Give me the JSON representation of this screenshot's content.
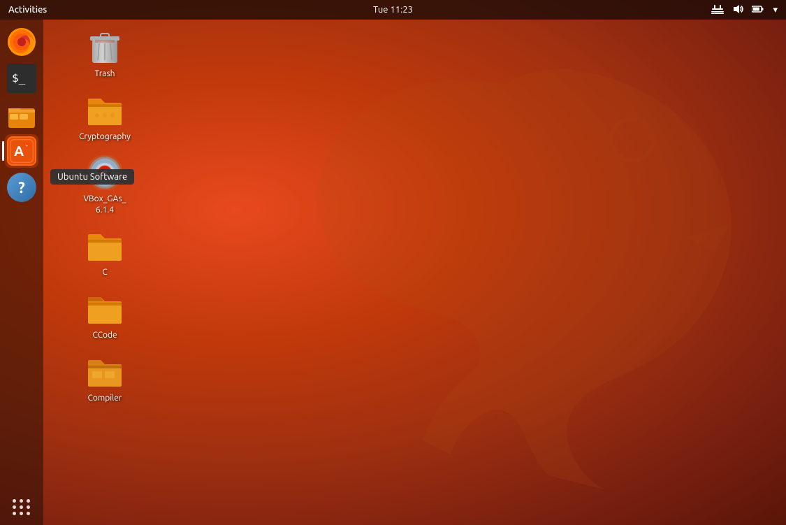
{
  "panel": {
    "activities_label": "Activities",
    "clock": "Tue 11:23",
    "icons": [
      {
        "name": "network-icon",
        "symbol": "⊞",
        "unicode": "🔗"
      },
      {
        "name": "volume-icon",
        "symbol": "🔊"
      },
      {
        "name": "battery-icon",
        "symbol": "🔋"
      },
      {
        "name": "menu-arrow-icon",
        "symbol": "▾"
      }
    ]
  },
  "dock": {
    "items": [
      {
        "name": "firefox",
        "label": "Firefox"
      },
      {
        "name": "terminal",
        "label": "Terminal"
      },
      {
        "name": "files",
        "label": "Files"
      },
      {
        "name": "ubuntu-software",
        "label": "Ubuntu Software",
        "active": true
      },
      {
        "name": "help",
        "label": "Help"
      }
    ],
    "apps_grid_label": "Show Applications"
  },
  "tooltip": {
    "text": "Ubuntu Software"
  },
  "desktop_icons": [
    {
      "name": "trash",
      "label": "Trash",
      "type": "trash"
    },
    {
      "name": "cryptography",
      "label": "Cryptography",
      "type": "folder"
    },
    {
      "name": "vbox-gas",
      "label": "VBox_GAs_\n6.1.4",
      "type": "cd"
    },
    {
      "name": "c-folder",
      "label": "C",
      "type": "folder"
    },
    {
      "name": "ccode-folder",
      "label": "CCode",
      "type": "folder"
    },
    {
      "name": "compiler-folder",
      "label": "Compiler",
      "type": "folder"
    }
  ]
}
